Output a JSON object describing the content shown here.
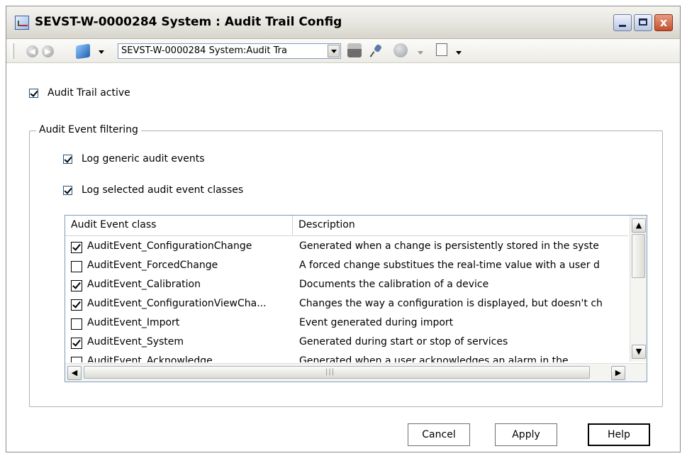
{
  "window": {
    "title": "SEVST-W-0000284 System : Audit Trail Config",
    "close_glyph": "x"
  },
  "toolbar": {
    "address_value": "SEVST-W-0000284 System:Audit Tra"
  },
  "audit_trail_active": {
    "label": "Audit Trail active",
    "checked": true
  },
  "filtering": {
    "legend": "Audit Event filtering",
    "log_generic": {
      "label": "Log generic audit events",
      "checked": true
    },
    "log_selected": {
      "label": "Log selected audit event classes",
      "checked": true
    }
  },
  "table": {
    "columns": [
      "Audit Event class",
      "Description"
    ],
    "rows": [
      {
        "checked": true,
        "cls": "AuditEvent_ConfigurationChange",
        "desc": "Generated when a change is persistently stored in the syste"
      },
      {
        "checked": false,
        "cls": "AuditEvent_ForcedChange",
        "desc": "A forced change substitues the real-time value with a user d"
      },
      {
        "checked": true,
        "cls": "AuditEvent_Calibration",
        "desc": "Documents the calibration of a device"
      },
      {
        "checked": true,
        "cls": "AuditEvent_ConfigurationViewCha...",
        "desc": "Changes the way a configuration is displayed, but doesn't ch"
      },
      {
        "checked": false,
        "cls": "AuditEvent_Import",
        "desc": "Event generated during import"
      },
      {
        "checked": true,
        "cls": "AuditEvent_System",
        "desc": "Generated during start or stop of services"
      },
      {
        "checked": false,
        "cls": "AuditEvent_Acknowledge",
        "desc": "Generated when a user acknowledges an alarm in the"
      }
    ]
  },
  "buttons": {
    "cancel": "Cancel",
    "apply": "Apply",
    "help": "Help"
  }
}
